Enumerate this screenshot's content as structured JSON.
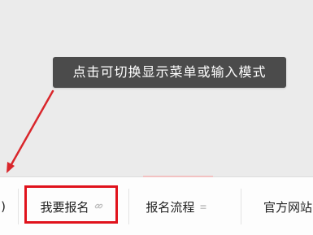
{
  "tooltip": {
    "text": "点击可切换显示菜单或输入模式"
  },
  "menu_bar": {
    "left_glyph": ")",
    "items": [
      {
        "label": "我要报名",
        "icon": "link-icon",
        "icon_glyph": "🔗"
      },
      {
        "label": "报名流程",
        "icon": "menu-lines-icon",
        "icon_glyph": "≡"
      },
      {
        "label": "官方网站"
      }
    ]
  },
  "colors": {
    "highlight": "#e0121c",
    "tooltip_bg": "#4b4b4b",
    "arrow": "#d9262b"
  }
}
